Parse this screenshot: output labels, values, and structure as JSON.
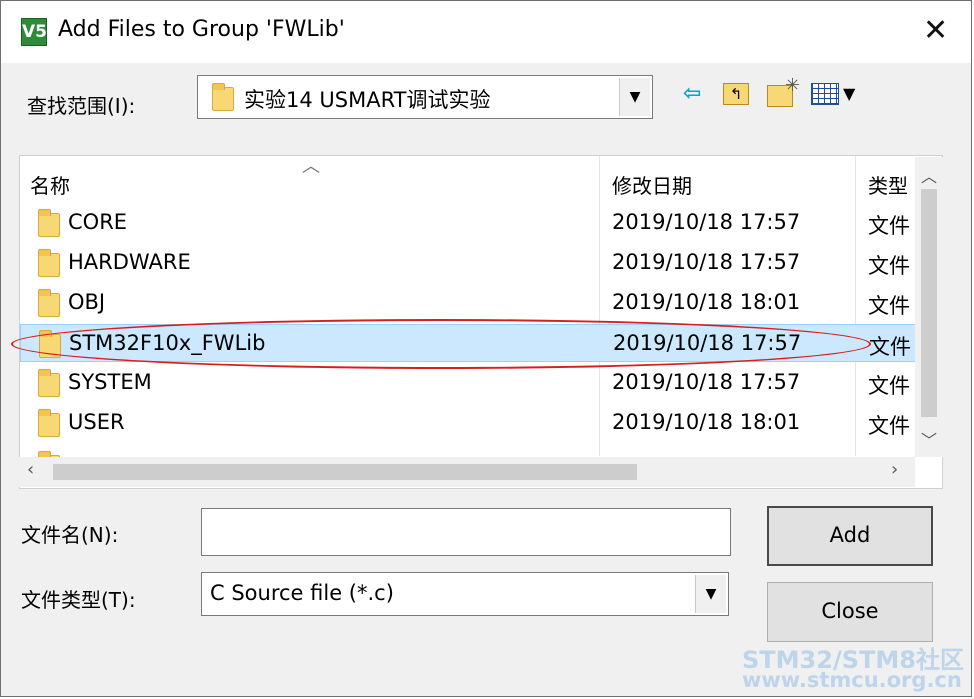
{
  "window": {
    "title": "Add Files to Group 'FWLib'",
    "app_icon_glyph": "V5",
    "close_glyph": "✕"
  },
  "lookin": {
    "label": "查找范围(I):",
    "value": "实验14 USMART调试实验",
    "toolbar": {
      "back_icon": "back-arrow-icon",
      "up_icon": "up-folder-icon",
      "new_icon": "new-folder-icon",
      "view_icon": "view-menu-icon"
    }
  },
  "filelist": {
    "columns": {
      "name": "名称",
      "date": "修改日期",
      "type": "类型"
    },
    "rows": [
      {
        "name": "CORE",
        "date": "2019/10/18 17:57",
        "type": "文件"
      },
      {
        "name": "HARDWARE",
        "date": "2019/10/18 17:57",
        "type": "文件"
      },
      {
        "name": "OBJ",
        "date": "2019/10/18 18:01",
        "type": "文件"
      },
      {
        "name": "STM32F10x_FWLib",
        "date": "2019/10/18 17:57",
        "type": "文件",
        "selected": true
      },
      {
        "name": "SYSTEM",
        "date": "2019/10/18 17:57",
        "type": "文件"
      },
      {
        "name": "USER",
        "date": "2019/10/18 18:01",
        "type": "文件"
      }
    ],
    "highlight_color": "#d62020",
    "selection_color": "#cce8ff"
  },
  "filename": {
    "label": "文件名(N):",
    "value": ""
  },
  "filetype": {
    "label": "文件类型(T):",
    "value": "C Source file (*.c)"
  },
  "buttons": {
    "add": "Add",
    "close": "Close"
  },
  "watermark": {
    "line1": "STM32/STM8社区",
    "line2": "www.stmcu.org.cn"
  }
}
